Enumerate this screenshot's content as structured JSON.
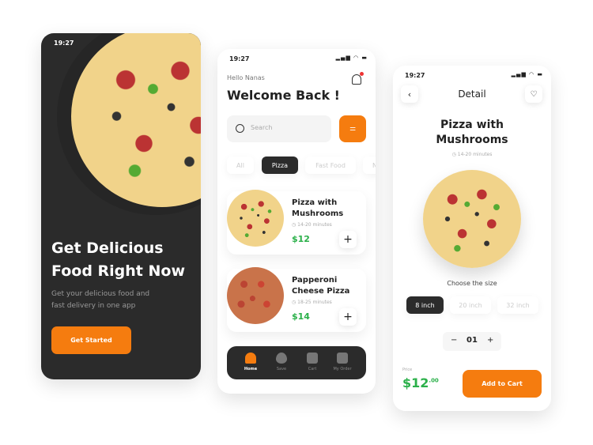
{
  "colors": {
    "accent": "#f57c0f",
    "dark": "#2b2b2b",
    "price": "#2bb04a"
  },
  "status": {
    "time": "19:27",
    "icons": [
      "signal-icon",
      "wifi-icon",
      "battery-icon"
    ]
  },
  "onboarding": {
    "title_line1": "Get Delicious",
    "title_line2": "Food Right Now",
    "subtitle_line1": "Get your delicious food and",
    "subtitle_line2": "fast delivery in one app",
    "button": "Get Started"
  },
  "home": {
    "greeting": "Hello Nanas",
    "title": "Welcome Back !",
    "search_placeholder": "Search",
    "categories": [
      {
        "label": "All",
        "selected": false
      },
      {
        "label": "Pizza",
        "selected": true
      },
      {
        "label": "Fast Food",
        "selected": false
      },
      {
        "label": "N",
        "selected": false
      }
    ],
    "items": [
      {
        "name_line1": "Pizza with",
        "name_line2": "Mushrooms",
        "time": "14-20 minutes",
        "price": "$12"
      },
      {
        "name_line1": "Papperoni",
        "name_line2": "Cheese Pizza",
        "time": "18-25 minutes",
        "price": "$14"
      }
    ],
    "nav": [
      {
        "label": "Home",
        "icon": "home-icon",
        "active": true
      },
      {
        "label": "Save",
        "icon": "heart-icon",
        "active": false
      },
      {
        "label": "Cart",
        "icon": "bag-icon",
        "active": false
      },
      {
        "label": "My Order",
        "icon": "document-icon",
        "active": false
      }
    ]
  },
  "detail": {
    "header": "Detail",
    "name_line1": "Pizza with",
    "name_line2": "Mushrooms",
    "time": "14-20 minutes",
    "size_label": "Choose the size",
    "sizes": [
      {
        "label": "8 inch",
        "selected": true
      },
      {
        "label": "20 inch",
        "selected": false
      },
      {
        "label": "32 inch",
        "selected": false
      }
    ],
    "quantity": "01",
    "minus": "−",
    "plus": "+",
    "price_label": "Price",
    "price": "$12",
    "price_cents": ".00",
    "button": "Add to Cart"
  }
}
